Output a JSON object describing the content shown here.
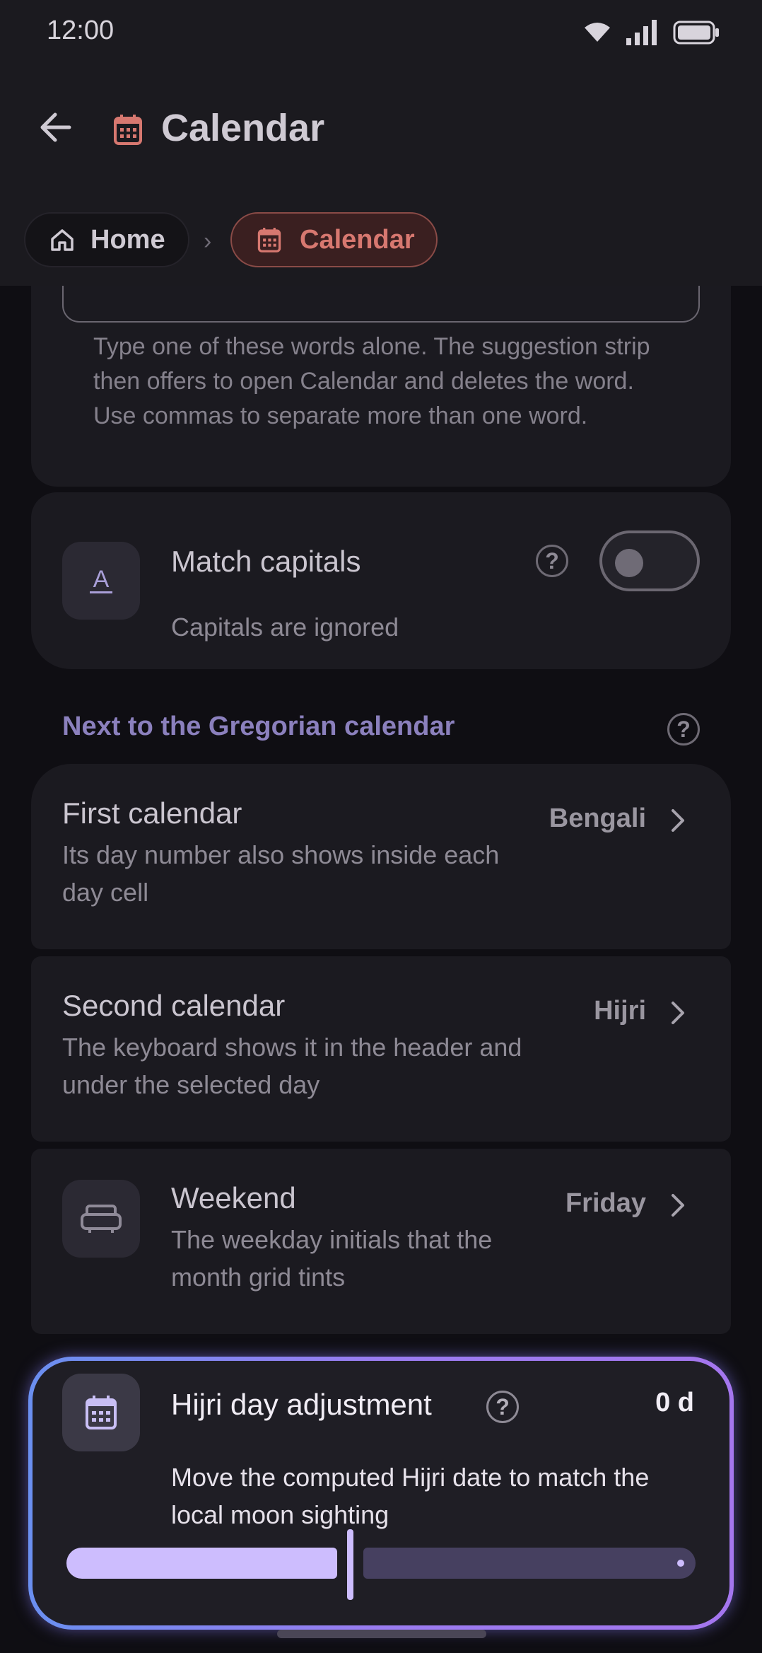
{
  "status": {
    "time": "12:00"
  },
  "header": {
    "title": "Calendar"
  },
  "breadcrumb": {
    "home": "Home",
    "current": "Calendar"
  },
  "keyword_card": {
    "help_text": "Type one of these words alone. The suggestion strip then offers to open Calendar and deletes the word. Use commas to separate more than one word."
  },
  "match_capitals": {
    "title": "Match capitals",
    "subtitle": "Capitals are ignored",
    "enabled": false
  },
  "section": {
    "title": "Next to the Gregorian calendar"
  },
  "first_calendar": {
    "title": "First calendar",
    "desc": "Its day number also shows inside each day cell",
    "value": "Bengali"
  },
  "second_calendar": {
    "title": "Second calendar",
    "desc": "The keyboard shows it in the header and under the selected day",
    "value": "Hijri"
  },
  "weekend": {
    "title": "Weekend",
    "desc": "The weekday initials that the month grid tints",
    "value": "Friday"
  },
  "hijri_adjust": {
    "title": "Hijri day adjustment",
    "desc": "Move the computed Hijri date to match the local moon sighting",
    "value": "0 d",
    "slider_fraction": 0.5
  },
  "colors": {
    "accent": "#cdbdfe",
    "brand_red": "#d77870",
    "section_purple": "#8b80bd"
  }
}
